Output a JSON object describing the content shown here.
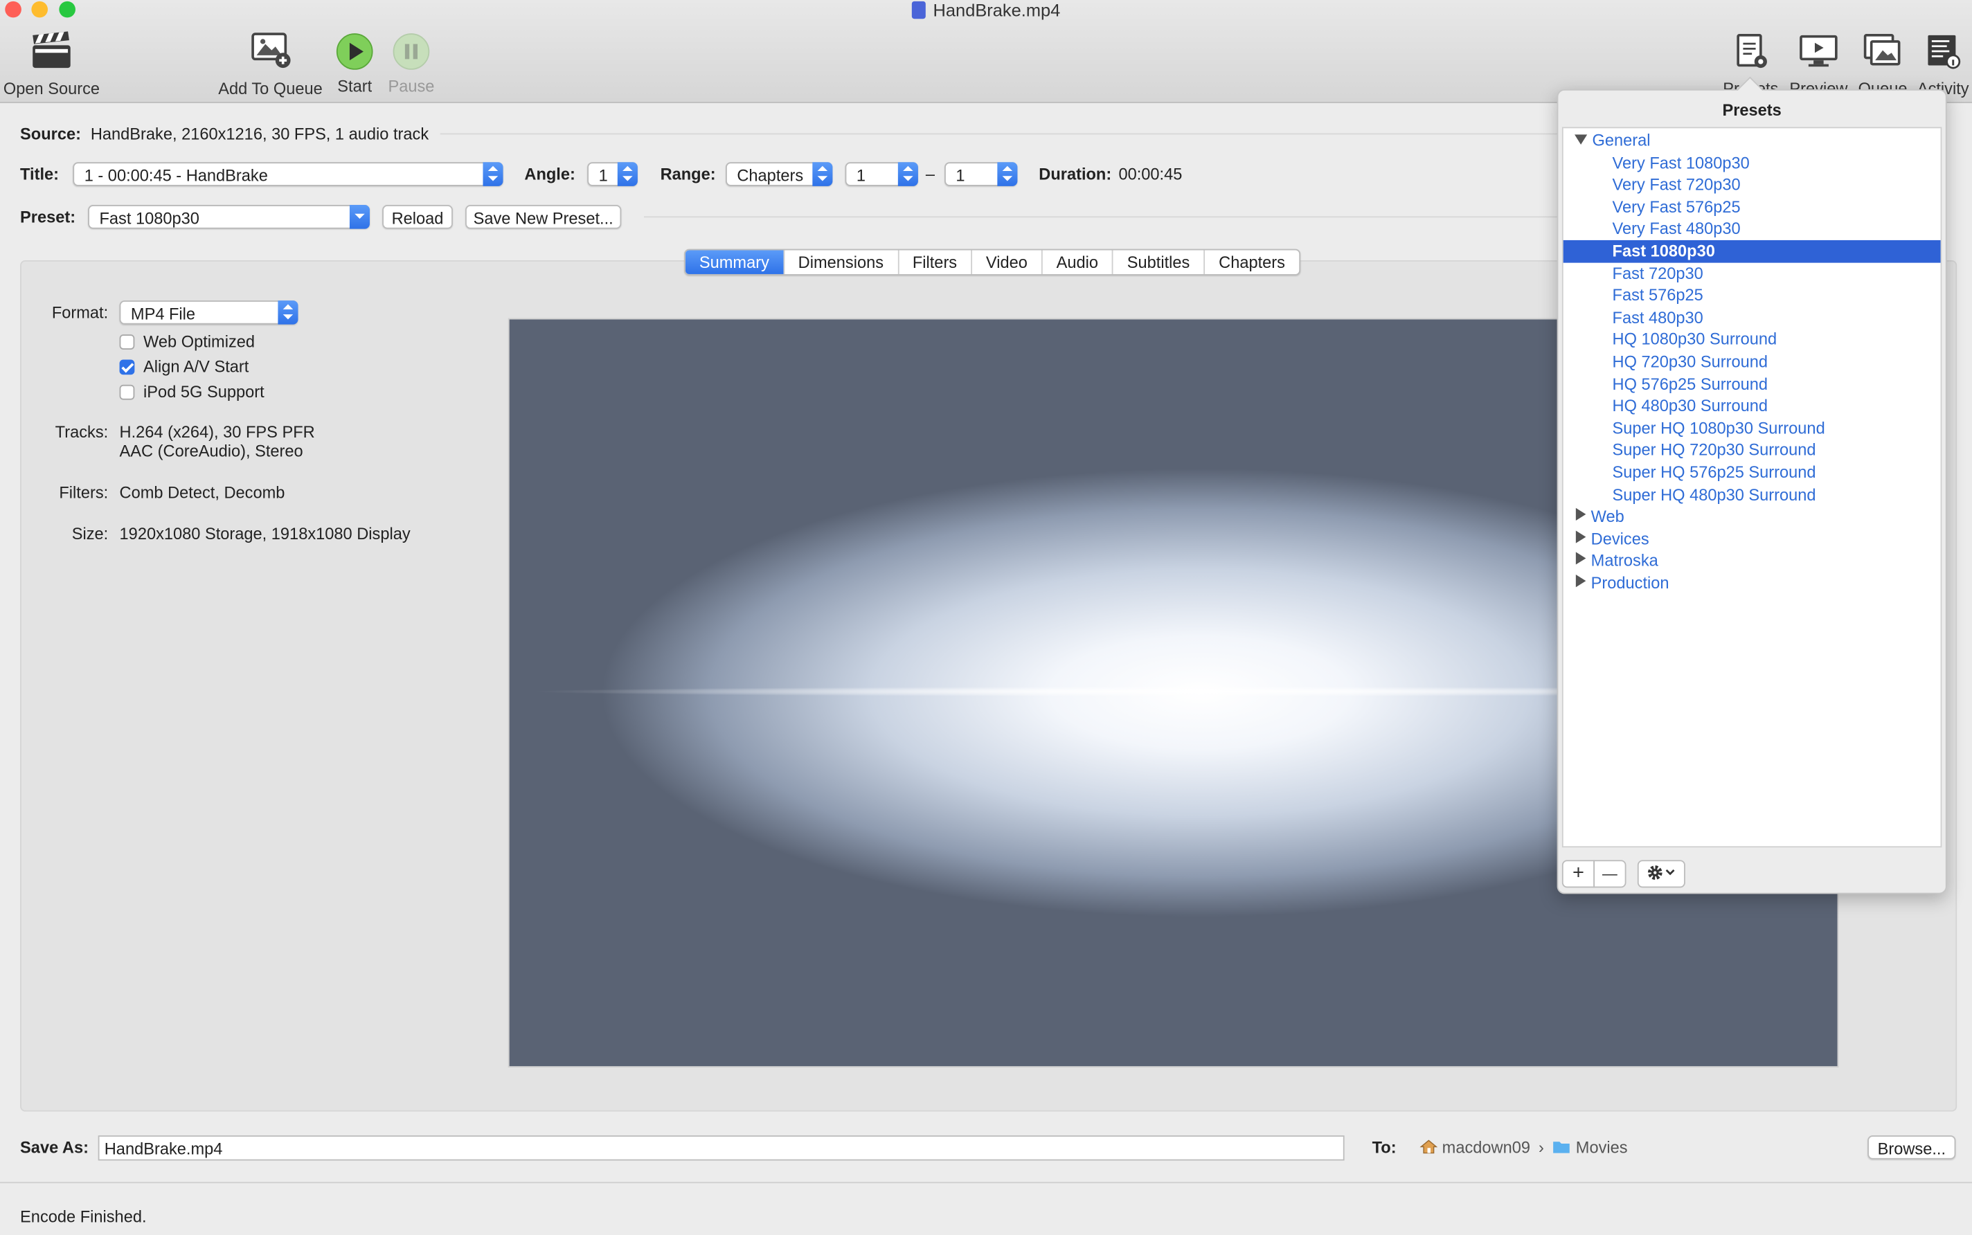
{
  "window": {
    "title": "HandBrake.mp4"
  },
  "toolbar": {
    "open_source": "Open Source",
    "add_to_queue": "Add To Queue",
    "start": "Start",
    "pause": "Pause",
    "presets": "Presets",
    "preview": "Preview",
    "queue": "Queue",
    "activity": "Activity"
  },
  "source": {
    "label": "Source:",
    "value": "HandBrake, 2160x1216, 30 FPS, 1 audio track"
  },
  "title_row": {
    "title_label": "Title:",
    "title_value": "1 - 00:00:45 - HandBrake",
    "angle_label": "Angle:",
    "angle_value": "1",
    "range_label": "Range:",
    "range_value": "Chapters",
    "range_from": "1",
    "range_dash": "–",
    "range_to": "1",
    "duration_label": "Duration:",
    "duration_value": "00:00:45"
  },
  "preset_row": {
    "label": "Preset:",
    "value": "Fast 1080p30",
    "reload": "Reload",
    "save_new": "Save New Preset..."
  },
  "tabs": [
    "Summary",
    "Dimensions",
    "Filters",
    "Video",
    "Audio",
    "Subtitles",
    "Chapters"
  ],
  "summary": {
    "format_label": "Format:",
    "format_value": "MP4 File",
    "web_optimized": "Web Optimized",
    "align_av": "Align A/V Start",
    "ipod": "iPod 5G Support",
    "tracks_label": "Tracks:",
    "tracks_line1": "H.264 (x264), 30 FPS PFR",
    "tracks_line2": "AAC (CoreAudio), Stereo",
    "filters_label": "Filters:",
    "filters_value": "Comb Detect, Decomb",
    "size_label": "Size:",
    "size_value": "1920x1080 Storage, 1918x1080 Display"
  },
  "save": {
    "label": "Save As:",
    "value": "HandBrake.mp4",
    "to_label": "To:",
    "home": "macdown09",
    "sep": "›",
    "folder": "Movies",
    "browse": "Browse..."
  },
  "status": "Encode Finished.",
  "presets_popover": {
    "title": "Presets",
    "groups": [
      {
        "name": "General",
        "expanded": true,
        "items": [
          "Very Fast 1080p30",
          "Very Fast 720p30",
          "Very Fast 576p25",
          "Very Fast 480p30",
          "Fast 1080p30",
          "Fast 720p30",
          "Fast 576p25",
          "Fast 480p30",
          "HQ 1080p30 Surround",
          "HQ 720p30 Surround",
          "HQ 576p25 Surround",
          "HQ 480p30 Surround",
          "Super HQ 1080p30 Surround",
          "Super HQ 720p30 Surround",
          "Super HQ 576p25 Surround",
          "Super HQ 480p30 Surround"
        ]
      },
      {
        "name": "Web",
        "expanded": false
      },
      {
        "name": "Devices",
        "expanded": false
      },
      {
        "name": "Matroska",
        "expanded": false
      },
      {
        "name": "Production",
        "expanded": false
      }
    ],
    "selected": "Fast 1080p30",
    "add": "+",
    "remove": "—"
  },
  "colors": {
    "accent": "#2f72e8",
    "selection": "#2f62d6",
    "preset_text": "#2f6cd6"
  }
}
